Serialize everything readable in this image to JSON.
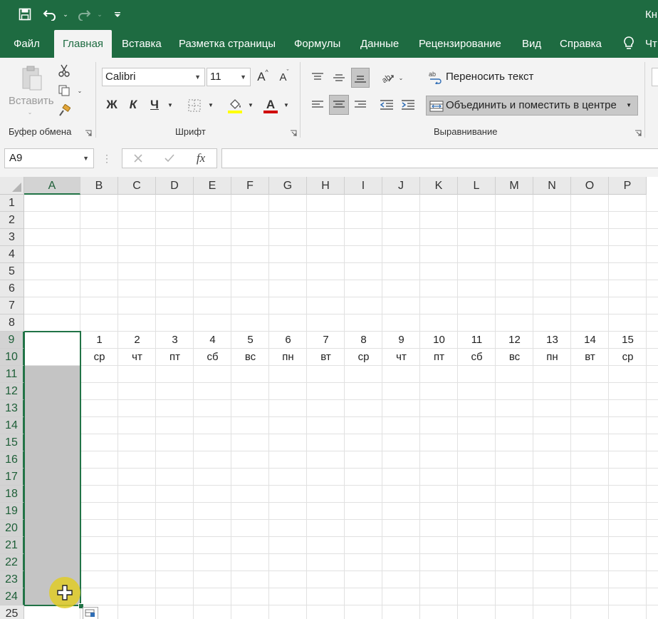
{
  "window": {
    "title": "Кн"
  },
  "tabs": [
    {
      "label": "Файл",
      "active": false
    },
    {
      "label": "Главная",
      "active": true
    },
    {
      "label": "Вставка",
      "active": false
    },
    {
      "label": "Разметка страницы",
      "active": false
    },
    {
      "label": "Формулы",
      "active": false
    },
    {
      "label": "Данные",
      "active": false
    },
    {
      "label": "Рецензирование",
      "active": false
    },
    {
      "label": "Вид",
      "active": false
    },
    {
      "label": "Справка",
      "active": false
    },
    {
      "label": "Чт",
      "active": false
    }
  ],
  "ribbon": {
    "clipboard": {
      "group_label": "Буфер обмена",
      "paste_label": "Вставить"
    },
    "font": {
      "group_label": "Шрифт",
      "font_name": "Calibri",
      "font_size": "11",
      "bold_label": "Ж",
      "italic_label": "К",
      "underline_label": "Ч",
      "highlight_color": "#ffff00",
      "font_color": "#d00000"
    },
    "alignment": {
      "group_label": "Выравнивание",
      "wrap_label": "Переносить текст",
      "merge_label": "Объединить и поместить в центре"
    }
  },
  "formula_bar": {
    "name_box": "A9",
    "fx_label": "fx",
    "formula": ""
  },
  "sheet": {
    "columns": [
      "A",
      "B",
      "C",
      "D",
      "E",
      "F",
      "G",
      "H",
      "I",
      "J",
      "K",
      "L",
      "M",
      "N",
      "O",
      "P"
    ],
    "rows": [
      "1",
      "2",
      "3",
      "4",
      "5",
      "6",
      "7",
      "8",
      "9",
      "10",
      "11",
      "12",
      "13",
      "14",
      "15",
      "16",
      "17",
      "18",
      "19",
      "20",
      "21",
      "22",
      "23",
      "24",
      "25"
    ],
    "selected_column": "A",
    "selected_range": "A9:A24",
    "row9": [
      "1",
      "2",
      "3",
      "4",
      "5",
      "6",
      "7",
      "8",
      "9",
      "10",
      "11",
      "12",
      "13",
      "14",
      "15"
    ],
    "row10": [
      "ср",
      "чт",
      "пт",
      "сб",
      "вс",
      "пн",
      "вт",
      "ср",
      "чт",
      "пт",
      "сб",
      "вс",
      "пн",
      "вт",
      "ср"
    ],
    "accent_color": "#217346"
  }
}
